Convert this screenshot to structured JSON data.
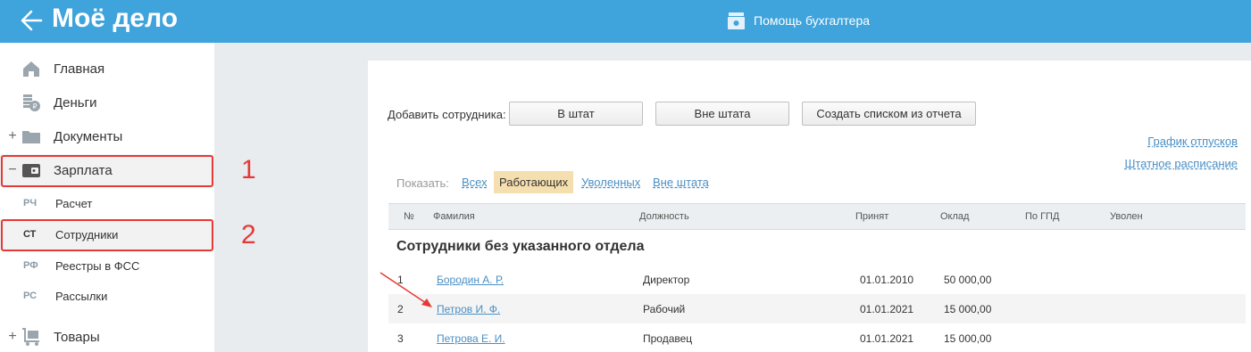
{
  "header": {
    "logo": "Моё дело",
    "help_label": "Помощь бухгалтера"
  },
  "sidebar": {
    "items": [
      {
        "label": "Главная",
        "icon": "home-icon",
        "toggle": ""
      },
      {
        "label": "Деньги",
        "icon": "money-icon",
        "toggle": ""
      },
      {
        "label": "Документы",
        "icon": "folder-icon",
        "toggle": "+"
      },
      {
        "label": "Зарплата",
        "icon": "wallet-icon",
        "toggle": "−"
      },
      {
        "label": "Товары",
        "icon": "cart-icon",
        "toggle": "+"
      }
    ],
    "subitems": [
      {
        "abbr": "РЧ",
        "label": "Расчет"
      },
      {
        "abbr": "СТ",
        "label": "Сотрудники"
      },
      {
        "abbr": "РФ",
        "label": "Реестры в ФСС"
      },
      {
        "abbr": "РС",
        "label": "Рассылки"
      }
    ]
  },
  "annotations": {
    "label_1": "1",
    "label_2": "2",
    "color": "#e53935"
  },
  "content": {
    "add_label": "Добавить сотрудника:",
    "buttons": {
      "in_staff": "В штат",
      "out_staff": "Вне штата",
      "from_report": "Создать списком из отчета"
    },
    "links": {
      "vacation_schedule": "График отпусков",
      "staff_schedule": "Штатное расписание"
    },
    "filter": {
      "label": "Показать:",
      "tabs": [
        "Всех",
        "Работающих",
        "Уволенных",
        "Вне штата"
      ],
      "selected": "Работающих"
    },
    "table": {
      "columns": [
        "№",
        "Фамилия",
        "Должность",
        "Принят",
        "Оклад",
        "По ГПД",
        "Уволен"
      ],
      "group_title": "Сотрудники без указанного отдела",
      "rows": [
        {
          "num": "1",
          "name": "Бородин А. Р.",
          "position": "Директор",
          "hired": "01.01.2010",
          "salary": "50 000,00"
        },
        {
          "num": "2",
          "name": "Петров И. Ф.",
          "position": "Рабочий",
          "hired": "01.01.2021",
          "salary": "15 000,00"
        },
        {
          "num": "3",
          "name": "Петрова Е. И.",
          "position": "Продавец",
          "hired": "01.01.2021",
          "salary": "15 000,00"
        }
      ]
    }
  },
  "colors": {
    "header_bg": "#3fa3dc",
    "link": "#4a8fc4",
    "selected_tab": "#f6dfae"
  }
}
